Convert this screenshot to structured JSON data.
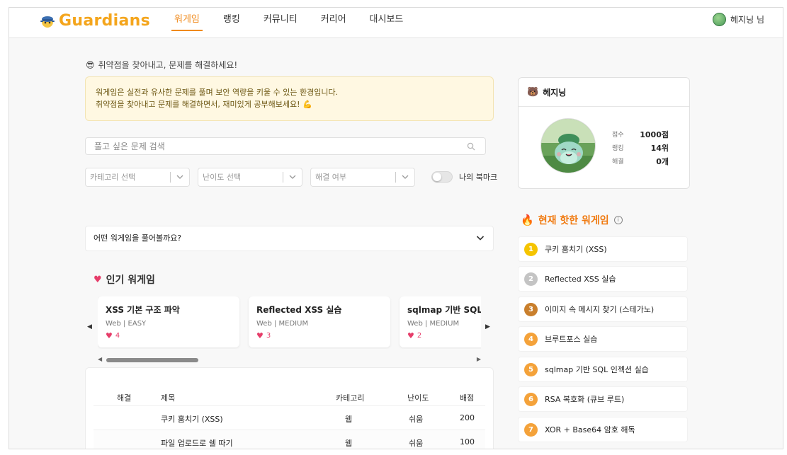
{
  "header": {
    "logo_text": "Guardians",
    "nav": [
      {
        "label": "워게임",
        "active": true
      },
      {
        "label": "랭킹",
        "active": false
      },
      {
        "label": "커뮤니티",
        "active": false
      },
      {
        "label": "커리어",
        "active": false
      },
      {
        "label": "대시보드",
        "active": false
      }
    ],
    "user_name": "헤지닝 님"
  },
  "intro": {
    "emoji": "😎",
    "text": "취약점을 찾아내고, 문제를 해결하세요!"
  },
  "notice": {
    "line1": "워게임은 실전과 유사한 문제를 풀며 보안 역량을 키울 수 있는 환경입니다.",
    "line2": "취약점을 찾아내고 문제를 해결하면서, 재미있게 공부해보세요! 💪"
  },
  "search": {
    "placeholder": "풀고 싶은 문제 검색",
    "value": ""
  },
  "filters": {
    "category": "카테고리 선택",
    "difficulty": "난이도 선택",
    "solved": "해결 여부",
    "bookmark_label": "나의 북마크",
    "bookmark_on": false
  },
  "accordion": {
    "label": "어떤 워게임을 풀어볼까요?"
  },
  "popular": {
    "title": "인기 워게임",
    "cards": [
      {
        "title": "XSS 기본 구조 파악",
        "meta": "Web | EASY",
        "likes": "4"
      },
      {
        "title": "Reflected XSS 실습",
        "meta": "Web | MEDIUM",
        "likes": "3"
      },
      {
        "title": "sqlmap 기반 SQL 인젝션 실습",
        "meta": "Web | MEDIUM",
        "likes": "2"
      }
    ]
  },
  "table": {
    "headers": {
      "solved": "해결",
      "title": "제목",
      "category": "카테고리",
      "difficulty": "난이도",
      "points": "배점"
    },
    "rows": [
      {
        "solved": "",
        "title": "쿠키 훔치기 (XSS)",
        "category": "웹",
        "difficulty": "쉬움",
        "points": "200"
      },
      {
        "solved": "",
        "title": "파일 업로드로 쉘 따기",
        "category": "웹",
        "difficulty": "쉬움",
        "points": "100"
      }
    ]
  },
  "profile": {
    "name": "헤지닝",
    "stats": [
      {
        "label": "점수",
        "value": "1000점"
      },
      {
        "label": "랭킹",
        "value": "14위"
      },
      {
        "label": "해결",
        "value": "0개"
      }
    ]
  },
  "hot": {
    "title": "현재 핫한 워게임",
    "items": [
      {
        "rank": "1",
        "label": "쿠키 훔치기 (XSS)",
        "color": "#f5c400"
      },
      {
        "rank": "2",
        "label": "Reflected XSS 실습",
        "color": "#c4c4c4"
      },
      {
        "rank": "3",
        "label": "이미지 속 메시지 찾기 (스테가노)",
        "color": "#c97f2c"
      },
      {
        "rank": "4",
        "label": "브루트포스 실습",
        "color": "#f4a23a"
      },
      {
        "rank": "5",
        "label": "sqlmap 기반 SQL 인젝션 실습",
        "color": "#f4a23a"
      },
      {
        "rank": "6",
        "label": "RSA 복호화 (큐브 루트)",
        "color": "#f4a23a"
      },
      {
        "rank": "7",
        "label": "XOR + Base64 암호 해독",
        "color": "#f4a23a"
      }
    ]
  },
  "colors": {
    "accent": "#f08a1c",
    "logo": "#f4a51c",
    "notice_bg": "#fff8e2",
    "heart": "#e63d6a"
  }
}
